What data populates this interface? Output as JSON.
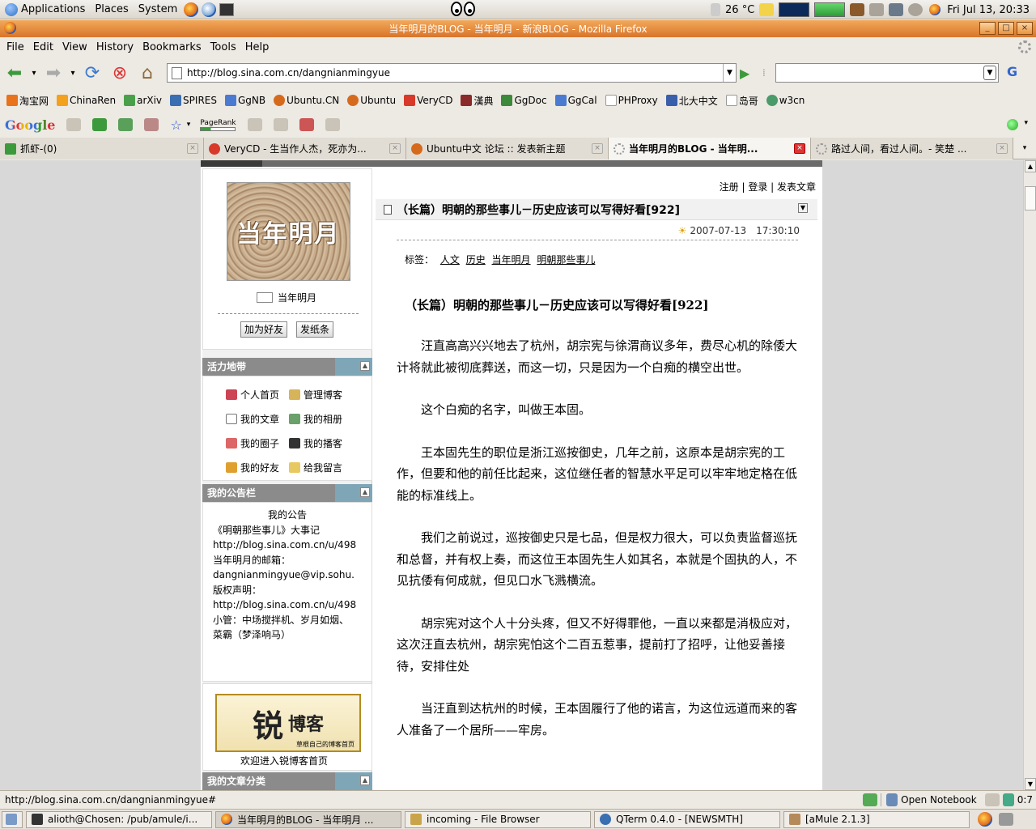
{
  "top_panel": {
    "menus": [
      "Applications",
      "Places",
      "System"
    ],
    "weather": "26 °C",
    "clock": "Fri Jul 13, 20:33"
  },
  "window": {
    "title": "当年明月的BLOG - 当年明月 - 新浪BLOG - Mozilla Firefox"
  },
  "menubar": [
    "File",
    "Edit",
    "View",
    "History",
    "Bookmarks",
    "Tools",
    "Help"
  ],
  "navigation": {
    "url": "http://blog.sina.com.cn/dangnianmingyue",
    "search_value": ""
  },
  "bookmarks": [
    {
      "label": "淘宝网",
      "color": "#e8731a"
    },
    {
      "label": "ChinaRen",
      "color": "#f4a11e"
    },
    {
      "label": "arXiv",
      "color": "#4aa04a"
    },
    {
      "label": "SPIRES",
      "color": "#3a6fb2"
    },
    {
      "label": "GgNB",
      "color": "#4a7bd1"
    },
    {
      "label": "Ubuntu.CN",
      "color": "#d56a1d"
    },
    {
      "label": "Ubuntu",
      "color": "#d56a1d"
    },
    {
      "label": "VeryCD",
      "color": "#d73a2a"
    },
    {
      "label": "漢典",
      "color": "#8a2a2a"
    },
    {
      "label": "GgDoc",
      "color": "#3a8a3a"
    },
    {
      "label": "GgCal",
      "color": "#4a7bd1"
    },
    {
      "label": "PHProxy",
      "color": "#999999"
    },
    {
      "label": "北大中文",
      "color": "#3a5faa"
    },
    {
      "label": "岛哥",
      "color": "#999999"
    },
    {
      "label": "w3cn",
      "color": "#4a9a6a"
    }
  ],
  "google_toolbar": {
    "logo": "Google",
    "pagerank_label": "PageRank"
  },
  "tabs": [
    {
      "label": "抓虾-(0)",
      "active": false
    },
    {
      "label": "VeryCD - 生当作人杰，死亦为...",
      "active": false
    },
    {
      "label": "Ubuntu中文 论坛 :: 发表新主题",
      "active": false
    },
    {
      "label": "当年明月的BLOG - 当年明...",
      "active": true
    },
    {
      "label": "路过人间，看过人间。- 笑楚 ...",
      "active": false
    }
  ],
  "blog": {
    "avatar_text": "当年明月",
    "username": "当年明月",
    "add_friend": "加为好友",
    "send_note": "发纸条",
    "vitality_title": "活力地带",
    "vitality_links": [
      "个人首页",
      "管理博客",
      "我的文章",
      "我的相册",
      "我的圈子",
      "我的播客",
      "我的好友",
      "给我留言"
    ],
    "notice_title": "我的公告栏",
    "notice_lines": [
      "我的公告",
      "《明朝那些事儿》大事记",
      "http://blog.sina.com.cn/u/498",
      "当年明月的邮箱：",
      "dangnianmingyue@vip.sohu.",
      "版权声明：",
      "http://blog.sina.com.cn/u/498",
      "小管：中场搅拌机、岁月如烟、",
      "菜霸（梦泽响马）"
    ],
    "rui_logo_big": "锐",
    "rui_logo_mid": "博客",
    "rui_logo_sub": "草根自己的博客首页",
    "rui_text": "欢迎进入锐博客首页",
    "category_title": "我的文章分类",
    "user_links": "注册 | 登录 | 发表文章",
    "article_header": "（长篇）明朝的那些事儿－历史应该可以写得好看[922]",
    "date": "2007-07-13　17:30:10",
    "tags_label": "标签：",
    "tags": [
      "人文",
      "历史",
      "当年明月",
      "明朝那些事儿"
    ],
    "article_title": "（长篇）明朝的那些事儿－历史应该可以写得好看[922]",
    "paragraphs": [
      "汪直高高兴兴地去了杭州，胡宗宪与徐渭商议多年，费尽心机的除倭大计将就此被彻底葬送，而这一切，只是因为一个白痴的横空出世。",
      "这个白痴的名字，叫做王本固。",
      "王本固先生的职位是浙江巡按御史，几年之前，这原本是胡宗宪的工作，但要和他的前任比起来，这位继任者的智慧水平足可以牢牢地定格在低能的标准线上。",
      "我们之前说过，巡按御史只是七品，但是权力很大，可以负责监督巡抚和总督，并有权上奏，而这位王本固先生人如其名，本就是个固执的人，不见抗倭有何成就，但见口水飞溅横流。",
      "胡宗宪对这个人十分头疼，但又不好得罪他，一直以来都是消极应对，这次汪直去杭州，胡宗宪怕这个二百五惹事，提前打了招呼，让他妥善接待，安排住处",
      "当汪直到达杭州的时候，王本固履行了他的诺言，为这位远道而来的客人准备了一个居所——牢房。"
    ]
  },
  "statusbar": {
    "text": "http://blog.sina.com.cn/dangnianmingyue#",
    "open_notebook": "Open Notebook",
    "timer": "0:7"
  },
  "taskbar": [
    {
      "label": "alioth@Chosen: /pub/amule/i...",
      "active": false
    },
    {
      "label": "当年明月的BLOG - 当年明月 ...",
      "active": true
    },
    {
      "label": "incoming - File Browser",
      "active": false
    },
    {
      "label": "QTerm 0.4.0 - [NEWSMTH]",
      "active": false
    },
    {
      "label": "[aMule 2.1.3]",
      "active": false
    }
  ]
}
